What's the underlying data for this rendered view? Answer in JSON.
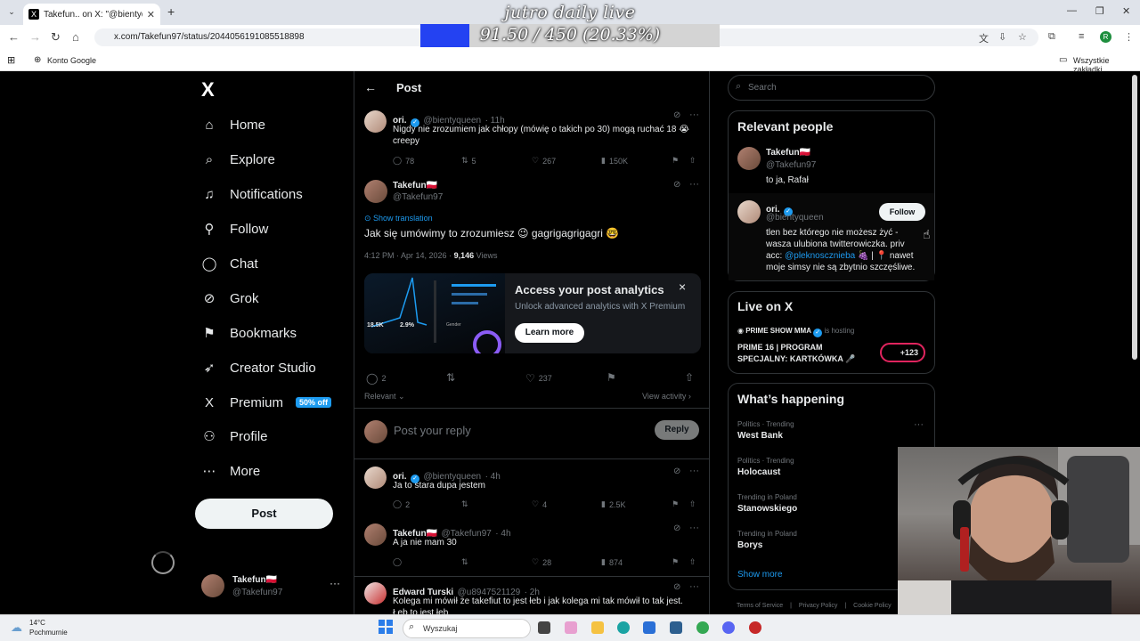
{
  "browser": {
    "tab_title": "Takefun.. on X: \"@bientyqueen",
    "url": "x.com/Takefun97/status/2044056191085518898",
    "bookmark_left": "Konto Google",
    "bookmark_right": "Wszystkie zakładki",
    "profile_initial": "R"
  },
  "overlay": {
    "title": "jutro daily live",
    "progress_text": "91.50 / 450 (20.33%)",
    "progress_fraction": 0.2033
  },
  "nav": {
    "logo": "X",
    "items": [
      {
        "label": "Home",
        "icon": "⌂"
      },
      {
        "label": "Explore",
        "icon": "⌕"
      },
      {
        "label": "Notifications",
        "icon": "♫"
      },
      {
        "label": "Follow",
        "icon": "⚲"
      },
      {
        "label": "Chat",
        "icon": "◯"
      },
      {
        "label": "Grok",
        "icon": "⊘"
      },
      {
        "label": "Bookmarks",
        "icon": "⚑"
      },
      {
        "label": "Creator Studio",
        "icon": "➶"
      },
      {
        "label": "Premium",
        "icon": "X"
      },
      {
        "label": "Profile",
        "icon": "⚇"
      },
      {
        "label": "More",
        "icon": "⋯"
      }
    ],
    "premium_badge": "50% off",
    "post_button": "Post",
    "account": {
      "name": "Takefun🇵🇱",
      "handle": "@Takefun97"
    }
  },
  "main": {
    "header": "Post",
    "parent": {
      "name": "ori.",
      "handle": "@bientyqueen",
      "time": "· 11h",
      "text": "Nigdy nie zrozumiem jak chłopy (mówię o takich po 30) mogą ruchać 18 😭 creepy",
      "replies": "78",
      "reposts": "5",
      "likes": "267",
      "views": "150K"
    },
    "focus": {
      "name": "Takefun🇵🇱",
      "handle": "@Takefun97",
      "show_translation": "Show translation",
      "text": "Jak się umówimy to zrozumiesz 😉 gagrigagrigagri 🤓",
      "timestamp": "4:12 PM · Apr 14, 2026 ·",
      "views_count": "9,146",
      "views_label": "Views",
      "replies": "2",
      "likes": "237"
    },
    "analytics": {
      "title": "Access your post analytics",
      "subtitle": "Unlock advanced analytics with X Premium",
      "button": "Learn more",
      "close": "×",
      "img_stat1": "18.5K",
      "img_stat2": "2.9%",
      "img_label": "Gender"
    },
    "sort": "Relevant",
    "view_activity": "View activity",
    "reply_placeholder": "Post your reply",
    "reply_button": "Reply",
    "replies": [
      {
        "name": "ori.",
        "handle": "@bientyqueen",
        "time": "· 4h",
        "text": "Ja to stara dupa jestem",
        "replies": "2",
        "likes": "4",
        "views": "2.5K"
      },
      {
        "name": "Takefun🇵🇱",
        "handle": "@Takefun97",
        "time": "· 4h",
        "text": "A ja nie mam 30",
        "replies": "",
        "likes": "28",
        "views": "874"
      },
      {
        "name": "Edward Turski",
        "handle": "@u8947521129",
        "time": "· 2h",
        "text": "Kolega mi mówił że takefiut to jest łeb i jak kolega mi tak mówił to tak jest.",
        "text2": "Łeb to jest łeb"
      }
    ]
  },
  "right": {
    "search_placeholder": "Search",
    "relevant_title": "Relevant people",
    "people": [
      {
        "name": "Takefun🇵🇱",
        "handle": "@Takefun97",
        "bio": "to ja, Rafał"
      },
      {
        "name": "ori.",
        "handle": "@bientyqueen",
        "bio1": "tlen bez którego nie możesz żyć -",
        "bio2": "wasza ulubiona twitterowiczka. priv",
        "bio3_pre": "acc:",
        "bio3_link": "@pleknoscznieba",
        "bio3_post": "🍇 | 📍 nawet",
        "bio4": "moje simsy nie są zbytnio szczęśliwe.",
        "follow": "Follow"
      }
    ],
    "live_title": "Live on X",
    "live_host": "PRIME SHOW MMA",
    "live_hosting": "is hosting",
    "live_line1": "PRIME 16 | PROGRAM",
    "live_line2": "SPECJALNY: KARTKÓWKA 🎤",
    "live_count": "+123",
    "happening_title": "What’s happening",
    "trends": [
      {
        "cat": "Politics · Trending",
        "name": "West Bank"
      },
      {
        "cat": "Politics · Trending",
        "name": "Holocaust"
      },
      {
        "cat": "Trending in Poland",
        "name": "Stanowskiego"
      },
      {
        "cat": "Trending in Poland",
        "name": "Borys"
      }
    ],
    "show_more": "Show more",
    "footer": [
      "Terms of Service",
      "Privacy Policy",
      "Cookie Policy"
    ]
  },
  "taskbar": {
    "weather_temp": "14°C",
    "weather_desc": "Pochmurnie",
    "search": "Wyszukaj"
  },
  "colors": {
    "accent": "#1d9bf0",
    "progress": "#2442f2"
  }
}
